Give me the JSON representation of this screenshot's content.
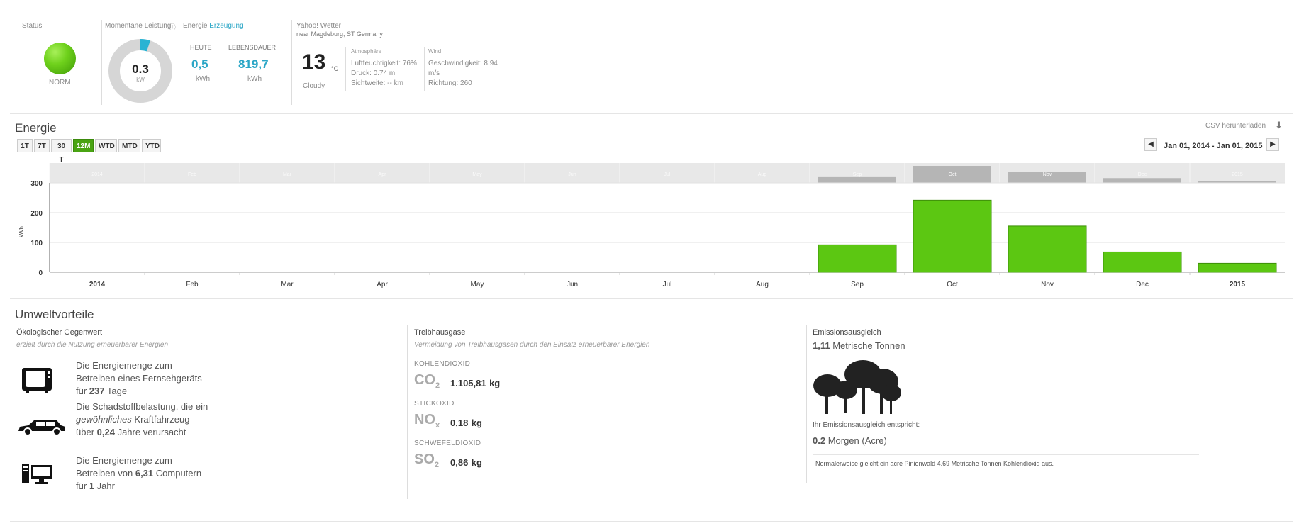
{
  "status": {
    "title": "Status",
    "state": "NORM",
    "color": "#6fd11c"
  },
  "power": {
    "title": "Momentane Leistung",
    "value": "0.3",
    "unit": "kW",
    "fraction": 0.05
  },
  "energy": {
    "title_prefix": "Energie",
    "title_link": "Erzeugung",
    "today_label": "HEUTE",
    "today_value": "0,5",
    "today_unit": "kWh",
    "lifetime_label": "LEBENSDAUER",
    "lifetime_value": "819,7",
    "lifetime_unit": "kWh"
  },
  "weather": {
    "title": "Yahoo! Wetter",
    "location": "near Magdeburg, ST Germany",
    "temp": "13",
    "temp_unit": "°C",
    "condition": "Cloudy",
    "atmo_title": "Atmosphäre",
    "humidity": "Luftfeuchtigkeit: 76%",
    "pressure": "Druck: 0.74 m",
    "visibility": "Sichtweite: -- km",
    "wind_title": "Wind",
    "wind_speed": "Geschwindigkeit: 8.94",
    "wind_unit": "m/s",
    "wind_dir": "Richtung: 260"
  },
  "energie_section": {
    "title": "Energie",
    "csv": "CSV herunterladen",
    "range_buttons": [
      "1T",
      "7T",
      "30 T",
      "12M",
      "WTD",
      "MTD",
      "YTD"
    ],
    "active_button": "12M",
    "date_range": "Jan 01, 2014 - Jan 01, 2015"
  },
  "chart_data": {
    "type": "bar",
    "categories": [
      "2014",
      "Feb",
      "Mar",
      "Apr",
      "May",
      "Jun",
      "Jul",
      "Aug",
      "Sep",
      "Oct",
      "Nov",
      "Dec",
      "2015"
    ],
    "bold_categories": [
      "2014",
      "2015"
    ],
    "values": [
      0,
      0,
      0,
      0,
      0,
      0,
      0,
      0,
      92,
      242,
      155,
      68,
      30
    ],
    "ylabel": "kWh",
    "yticks": [
      0,
      100,
      200,
      300
    ],
    "ylim": [
      0,
      300
    ],
    "bar_color": "#5cc712",
    "overview_color": "#b5b5b5"
  },
  "umwelt": {
    "title": "Umweltvorteile",
    "eco_title": "Ökologischer Gegenwert",
    "eco_sub": "erzielt durch die Nutzung erneuerbarer Energien",
    "tv_pre": "Die Energiemenge zum Betreiben eines Fernsehgeräts für ",
    "tv_num": "237",
    "tv_post": " Tage",
    "car_pre": "Die Schadstoffbelastung, die ein ",
    "car_italic": "gewöhnliches",
    "car_mid": " Kraftfahrzeug über ",
    "car_num": "0,24",
    "car_post": " Jahre verursacht",
    "pc_pre": "Die Energiemenge zum Betreiben von ",
    "pc_num": "6,31",
    "pc_post": " Computern für 1 Jahr",
    "gas_title": "Treibhausgase",
    "gas_sub": "Vermeidung von Treibhausgasen durch den Einsatz erneuerbarer Energien",
    "co2_name": "KOHLENDIOXID",
    "co2_f": "CO",
    "co2_sub": "2",
    "co2_val": "1.105,81",
    "co2_unit": "kg",
    "nox_name": "STICKOXID",
    "nox_f": "NO",
    "nox_sub": "x",
    "nox_val": "0,18",
    "nox_unit": "kg",
    "so2_name": "SCHWEFELDIOXID",
    "so2_f": "SO",
    "so2_sub": "2",
    "so2_val": "0,86",
    "so2_unit": "kg",
    "em_title": "Emissionsausgleich",
    "em_num": "1,11",
    "em_unit": " Metrische Tonnen",
    "em_equiv": "Ihr Emissionsausgleich entspricht:",
    "em_acre_num": "0.2",
    "em_acre_unit": " Morgen (Acre)",
    "em_note": "Normalerweise gleicht ein acre Pinienwald 4.69 Metrische Tonnen Kohlendioxid aus."
  }
}
